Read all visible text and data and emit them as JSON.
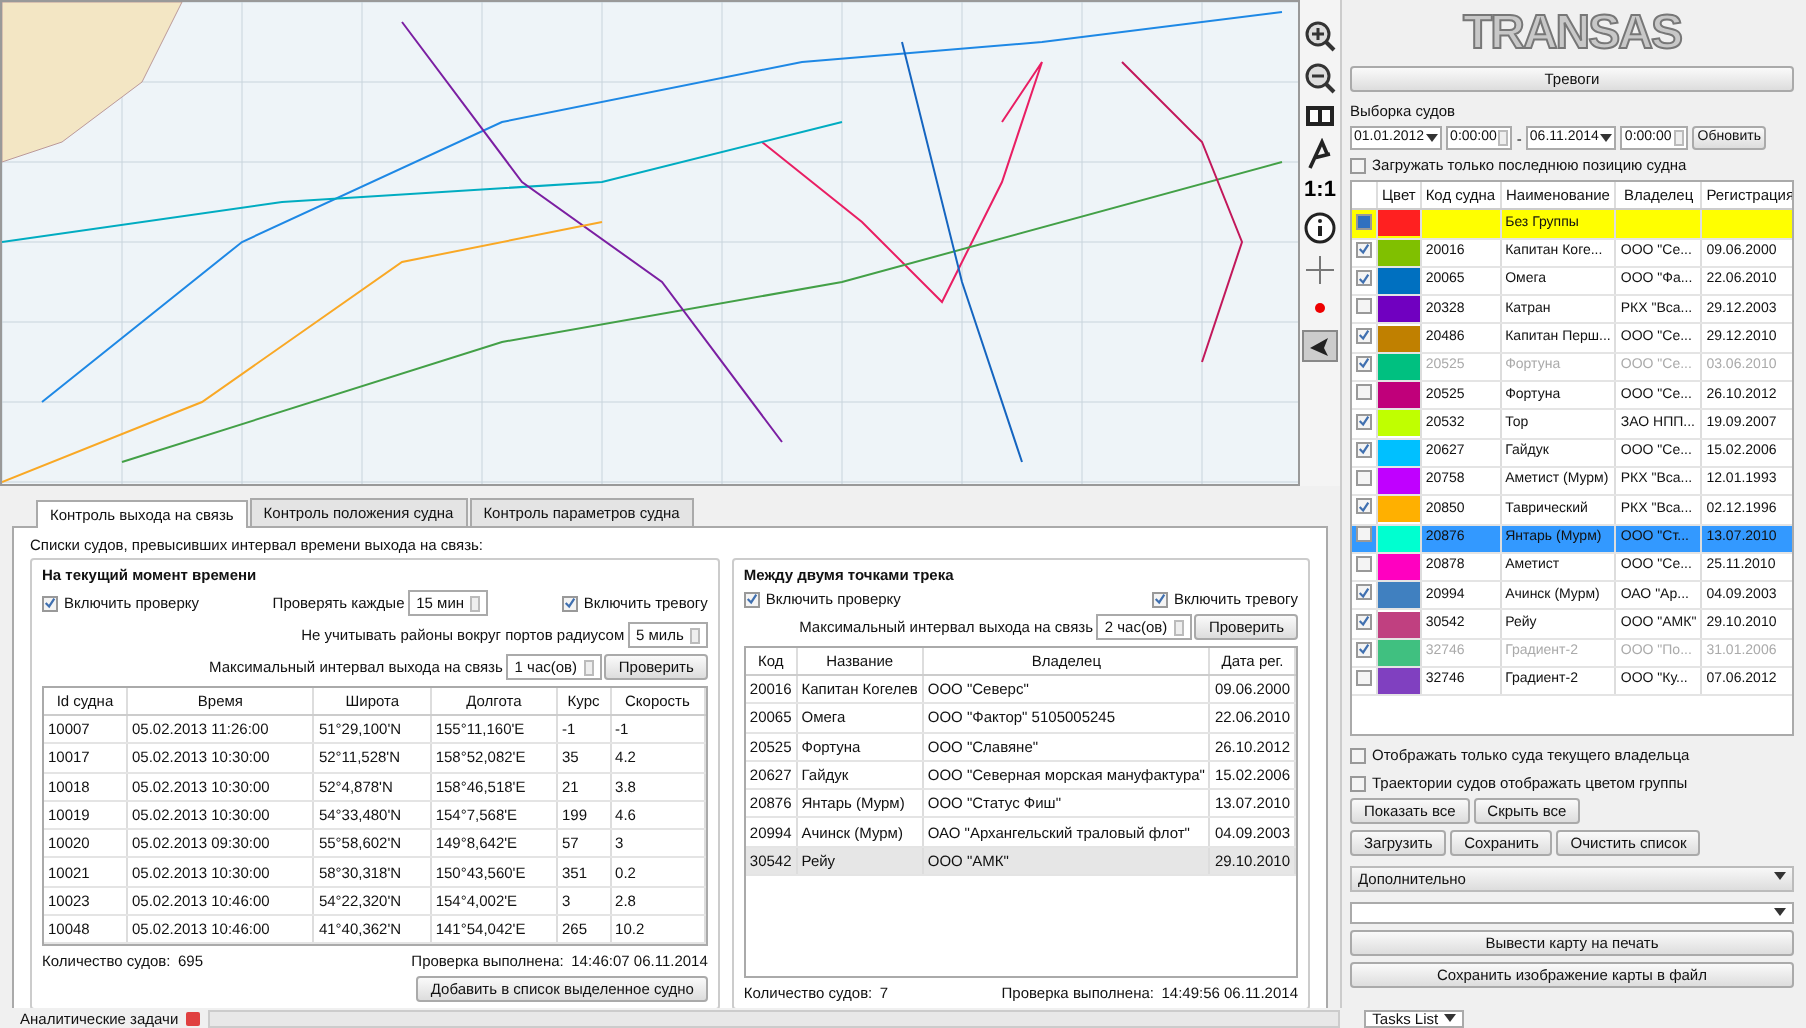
{
  "map_toolbar": {
    "scale_button": "1:1"
  },
  "right_panel": {
    "logo": "TRANSAS",
    "alarm_button": "Тревоги",
    "selection_title": "Выборка судов",
    "date_from": "01.01.2012",
    "time_from": "0:00:00",
    "dash": "-",
    "date_to": "06.11.2014",
    "time_to": "0:00:00",
    "refresh_button": "Обновить",
    "last_position_only": {
      "label": "Загружать только последнюю позицию судна",
      "checked": false
    },
    "vessels": {
      "columns": [
        "Цвет",
        "Код судна",
        "Наименование",
        "Владелец",
        "Регистрация"
      ],
      "rows": [
        {
          "kind": "group",
          "checked": true,
          "selected": false,
          "disabled": false,
          "color": "#ff2020",
          "code": "",
          "name": "Без Группы",
          "owner": "",
          "registered": ""
        },
        {
          "kind": "vessel",
          "checked": true,
          "selected": false,
          "disabled": false,
          "color": "#80c000",
          "code": "20016",
          "name": "Капитан Коге...",
          "owner": "ООО \"Се...",
          "registered": "09.06.2000"
        },
        {
          "kind": "vessel",
          "checked": true,
          "selected": false,
          "disabled": false,
          "color": "#0070c0",
          "code": "20065",
          "name": "Омега",
          "owner": "ООО \"Фа...",
          "registered": "22.06.2010"
        },
        {
          "kind": "vessel",
          "checked": false,
          "selected": false,
          "disabled": false,
          "color": "#7000c0",
          "code": "20328",
          "name": "Катран",
          "owner": "РКХ \"Вса...",
          "registered": "29.12.2003"
        },
        {
          "kind": "vessel",
          "checked": true,
          "selected": false,
          "disabled": false,
          "color": "#c08000",
          "code": "20486",
          "name": "Капитан Перш...",
          "owner": "ООО \"Се...",
          "registered": "29.12.2010"
        },
        {
          "kind": "vessel",
          "checked": true,
          "selected": false,
          "disabled": true,
          "color": "#00c080",
          "code": "20525",
          "name": "Фортуна",
          "owner": "ООО \"Се...",
          "registered": "03.06.2010"
        },
        {
          "kind": "vessel",
          "checked": false,
          "selected": false,
          "disabled": false,
          "color": "#c0007a",
          "code": "20525",
          "name": "Фортуна",
          "owner": "ООО \"Се...",
          "registered": "26.10.2012"
        },
        {
          "kind": "vessel",
          "checked": true,
          "selected": false,
          "disabled": false,
          "color": "#c0ff00",
          "code": "20532",
          "name": "Тор",
          "owner": "ЗАО НПП...",
          "registered": "19.09.2007"
        },
        {
          "kind": "vessel",
          "checked": true,
          "selected": false,
          "disabled": false,
          "color": "#00c0ff",
          "code": "20627",
          "name": "Гайдук",
          "owner": "ООО \"Се...",
          "registered": "15.02.2006"
        },
        {
          "kind": "vessel",
          "checked": false,
          "selected": false,
          "disabled": false,
          "color": "#c000ff",
          "code": "20758",
          "name": "Аметист (Мурм)",
          "owner": "РКХ \"Вса...",
          "registered": "12.01.1993"
        },
        {
          "kind": "vessel",
          "checked": true,
          "selected": false,
          "disabled": false,
          "color": "#ffb000",
          "code": "20850",
          "name": "Таврический",
          "owner": "РКХ \"Вса...",
          "registered": "02.12.1996"
        },
        {
          "kind": "vessel",
          "checked": false,
          "selected": true,
          "disabled": false,
          "color": "#00ffd0",
          "code": "20876",
          "name": "Янтарь (Мурм)",
          "owner": "ООО \"Ст...",
          "registered": "13.07.2010"
        },
        {
          "kind": "vessel",
          "checked": false,
          "selected": false,
          "disabled": false,
          "color": "#ff00c0",
          "code": "20878",
          "name": "Аметист",
          "owner": "ООО \"Се...",
          "registered": "25.11.2010"
        },
        {
          "kind": "vessel",
          "checked": true,
          "selected": false,
          "disabled": false,
          "color": "#4080c0",
          "code": "20994",
          "name": "Ачинск (Мурм)",
          "owner": "ОАО \"Ар...",
          "registered": "04.09.2003"
        },
        {
          "kind": "vessel",
          "checked": true,
          "selected": false,
          "disabled": false,
          "color": "#c04080",
          "code": "30542",
          "name": "Рейу",
          "owner": "ООО \"АМК\"",
          "registered": "29.10.2010"
        },
        {
          "kind": "vessel",
          "checked": true,
          "selected": false,
          "disabled": true,
          "color": "#40c080",
          "code": "32746",
          "name": "Градиент-2",
          "owner": "ООО \"По...",
          "registered": "31.01.2006"
        },
        {
          "kind": "vessel",
          "checked": false,
          "selected": false,
          "disabled": false,
          "color": "#8040c0",
          "code": "32746",
          "name": "Градиент-2",
          "owner": "ООО \"Ку...",
          "registered": "07.06.2012"
        }
      ]
    },
    "options": [
      {
        "label": "Отображать только суда текущего владельца",
        "checked": false
      },
      {
        "label": "Траектории судов отображать цветом группы",
        "checked": false
      }
    ],
    "buttons_row_1": [
      "Показать все",
      "Скрыть все"
    ],
    "buttons_row_2": [
      "Загрузить",
      "Сохранить",
      "Очистить список"
    ],
    "extra_section": "Дополнительно",
    "print_button": "Вывести карту на печать",
    "save_image_button": "Сохранить изображение карты в файл"
  },
  "tabs": [
    {
      "label": "Контроль выхода на связь",
      "selected": true
    },
    {
      "label": "Контроль положения судна",
      "selected": false
    },
    {
      "label": "Контроль параметров судна",
      "selected": false
    }
  ],
  "report_panel": {
    "title": "Списки судов, превысивших интервал времени выхода на связь:",
    "current": {
      "legend": "На текущий момент времени",
      "enable": {
        "label": "Включить проверку",
        "checked": true
      },
      "check_every_label": "Проверять каждые",
      "check_every_value": "15 мин",
      "alarm": {
        "label": "Включить тревогу",
        "checked": true
      },
      "ignore_label": "Не учитывать районы вокруг портов радиусом",
      "ignore_value": "5 миль",
      "max_label": "Максимальный интервал выхода на связь",
      "max_value": "1 час(ов)",
      "check_button": "Проверить",
      "columns": [
        "Id судна",
        "Время",
        "Широта",
        "Долгота",
        "Курс",
        "Скорость"
      ],
      "rows": [
        [
          "10007",
          "05.02.2013 11:26:00",
          "51°29,100'N",
          "155°11,160'E",
          "-1",
          "-1"
        ],
        [
          "10017",
          "05.02.2013 10:30:00",
          "52°11,528'N",
          "158°52,082'E",
          "35",
          "4.2"
        ],
        [
          "10018",
          "05.02.2013 10:30:00",
          "52°4,878'N",
          "158°46,518'E",
          "21",
          "3.8"
        ],
        [
          "10019",
          "05.02.2013 10:30:00",
          "54°33,480'N",
          "154°7,568'E",
          "199",
          "4.6"
        ],
        [
          "10020",
          "05.02.2013 09:30:00",
          "55°58,602'N",
          "149°8,642'E",
          "57",
          "3"
        ],
        [
          "10021",
          "05.02.2013 10:30:00",
          "58°30,318'N",
          "150°43,560'E",
          "351",
          "0.2"
        ],
        [
          "10023",
          "05.02.2013 10:46:00",
          "54°22,320'N",
          "154°4,002'E",
          "3",
          "2.8"
        ],
        [
          "10048",
          "05.02.2013 10:46:00",
          "41°40,362'N",
          "141°54,042'E",
          "265",
          "10.2"
        ]
      ],
      "count_label": "Количество судов:",
      "count": "695",
      "done_label": "Проверка выполнена:",
      "done_time": "14:46:07 06.11.2014",
      "add_button": "Добавить в список выделенное судно"
    },
    "track": {
      "legend": "Между двумя точками трека",
      "enable": {
        "label": "Включить проверку",
        "checked": true
      },
      "alarm": {
        "label": "Включить тревогу",
        "checked": true
      },
      "max_label": "Максимальный интервал выхода на связь",
      "max_value": "2 час(ов)",
      "check_button": "Проверить",
      "columns": [
        "Код",
        "Название",
        "Владелец",
        "Дата рег."
      ],
      "rows": [
        {
          "cells": [
            "20016",
            "Капитан Когелев",
            "ООО \"Северс\"",
            "09.06.2000"
          ],
          "selected": false
        },
        {
          "cells": [
            "20065",
            "Омега",
            "ООО \"Фактор\" 5105005245",
            "22.06.2010"
          ],
          "selected": false
        },
        {
          "cells": [
            "20525",
            "Фортуна",
            "ООО \"Славяне\"",
            "26.10.2012"
          ],
          "selected": false
        },
        {
          "cells": [
            "20627",
            "Гайдук",
            "ООО \"Северная морская мануфактура\"",
            "15.02.2006"
          ],
          "selected": false
        },
        {
          "cells": [
            "20876",
            "Янтарь (Мурм)",
            "ООО \"Статус Фиш\"",
            "13.07.2010"
          ],
          "selected": false
        },
        {
          "cells": [
            "20994",
            "Ачинск (Мурм)",
            "ОАО \"Архангельский траловый флот\"",
            "04.09.2003"
          ],
          "selected": false
        },
        {
          "cells": [
            "30542",
            "Рейу",
            "ООО \"АМК\"",
            "29.10.2010"
          ],
          "selected": true
        }
      ],
      "count_label": "Количество судов:",
      "count": "7",
      "done_label": "Проверка выполнена:",
      "done_time": "14:49:56 06.11.2014"
    }
  },
  "bottom_bar": {
    "analytic_tasks": "Аналитические задачи",
    "tasks_list": "Tasks List"
  }
}
